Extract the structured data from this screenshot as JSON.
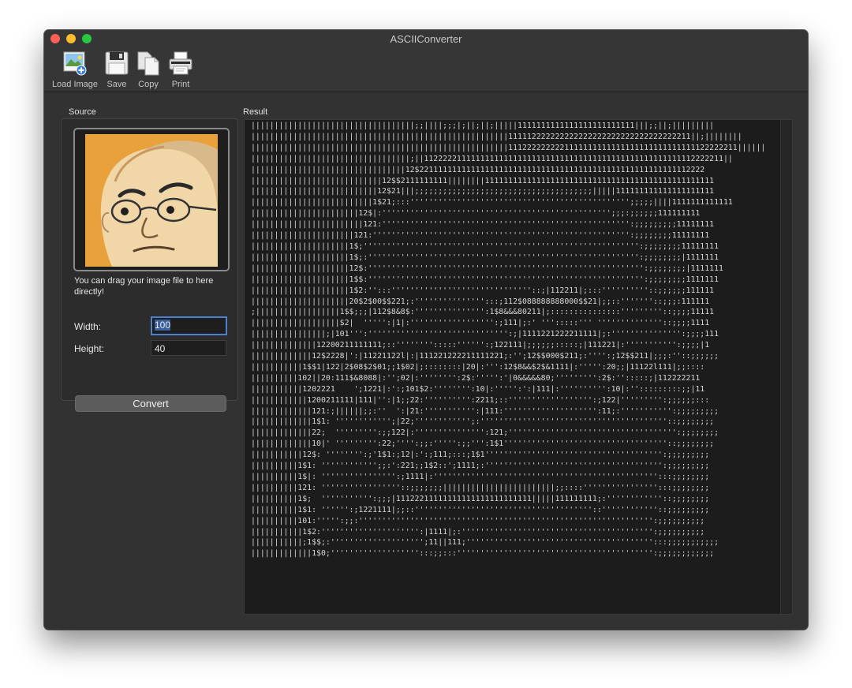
{
  "window": {
    "title": "ASCIIConverter"
  },
  "toolbar": {
    "load_label": "Load Image",
    "save_label": "Save",
    "copy_label": "Copy",
    "print_label": "Print"
  },
  "source": {
    "label": "Source",
    "drop_hint": "You can drag your image file to here directly!",
    "width_label": "Width:",
    "width_value": "100",
    "height_label": "Height:",
    "height_value": "40",
    "convert_label": "Convert"
  },
  "result": {
    "label": "Result",
    "lines": [
      "|||||||||||||||||||||||||||||||||||;;||||;;;|;||;||;|||||1111111111111111111111111|||;;||;|||||||||",
      "|||||||||||||||||||||||||||||||||||||||||||||||||||||||111112222222222222222222222222222222211||;||||||||",
      "|||||||||||||||||||||||||||||||||||||||||||||||||||||||1112222222221111111111111111111111111111122222211||||||",
      "||||||||||||||||||||||||||||||||||;||1122222111111111111111111111111111111111111111111111111112222211||",
      "|||||||||||||||||||||||||||||||||12$2211111111111111111111111111111111111111111111111111111112222",
      "||||||||||||||||||||||||||||12$$2111111111||||||||1111111111111111111111111111111111111111111111111",
      "|||||||||||||||||||||||||||12$21|||;;;;;;;;;;;;;;;;;;;;;;;;;;;;;;;;;;;;;;|||||111111111111111111111",
      "||||||||||||||||||||||||||1$21;:::''''''''''''''''''''''''''''''''''''''''''''''';;;;;||||1111111111111",
      "|||||||||||||||||||||||12$|:''''''''''''''''''''''''''''''''''''''''''''''''';;;:;;;;;;111111111",
      "||||||||||||||||||||||||121:''''''''''''''''''''''''''''''''''''''''''''''''''''':;;;;;;;;;11111111",
      "||||||||||||||||||||||121:''''''''''''''''''''''''''''''''''''''''''''''''''''''':;;;;;;;;11111111",
      "|||||||||||||||||||||1$;''''''''''''''''''''''''''''''''''''''''''''''''''''''''''':;;;;;;;;11111111",
      "|||||||||||||||||||||1$;:'''''''''''''''''''''''''''''''''''''''''''''''''''''''''':;;;;;;;;|1111111",
      "|||||||||||||||||||||12$:''''''''''''''''''''''''''''''''''''''''''''''''''''''''''':;;;;;;;;|1111111",
      "|||||||||||||||||||||1$$:''''''''''''''''''''''''''''''''''''''''''''''''''''''''''':;;;;;;;;1111111",
      "|||||||||||||||||||||1$2:'':::''''''''''''''''''''''''''''''::;|112211|;:::''''''''''::;;;;;;111111",
      "|||||||||||||||||||||20$2$00$$221;:''''''''''''''':::;112$088888888000$$21|;;::'''''''::;;;:111111",
      ";||||||||||||||||||1$$;;;|112$8&8$:''''''''''''''':1$8&&&80211|;:::::::::::::::'''''''''::;;;;11111",
      "|||||||||||||||||||$2|  ''''':|1|:'''''''''''''''''':;111|;:' ''':::::''' ''''''''''''''::;;;;1111",
      "||||||||||||||||;|101''':'''''''''''''''''''''''''''''':;|1111221222211111|;:''''''''''''''':;;;;111",
      "||||||||||||||12200211111111;::'''''''':::::'''''':;122111|;;;;;;:::::;|111221|:''''''''''':;;;;|1",
      "|||||||||||||12$2228|':|11221122l|:|111221222211111221;:'';12$$000$211;:'''':;12$$211|;;;:''::;;;;;;",
      "|||||||||||1$$1|122|2$08$2$01;;1$02|;::::::::|20|:''':12$8&&$2$&1111|:''''':20;;|11122l111|;;::::",
      "||||||||||102||20:111$&8088|:'';02|:'''''''':2$:''''':'|0&&&&&80;''''''''':2$:'':::::;|112222211",
      "|||||||||||1202221    ';1221|:':;101$2:'''''''':10|:''''':':|111|:'''''''''':10|:'':::::::::;;|11",
      "||||||||||||1200211111|111|'':|1;;22:'''''''''':2211;::'''''''''''''''''':;122|''''''''':;;;;;;:::",
      "|||||||||||||121:;||||||;;:''  ':|21:''''''''''':|111:'''''''''''''''''''':11;:''''''''''':;;;;;;;;;",
      "|||||||||||||1$1: '''''''''''';|22;'''''''''''';:''''''''''''''''''''''''''''''''''''''''::;;;;;;;;",
      "|||||||||||||22;  ''''''''':;;122|:''''''''''''''':121;'''''''''''''''''''''''''''''''''''':;;;;;;;;",
      "|||||||||||||10|' ''''''''':22;'''':;;:''''':;;''':1$1'''''''''''''''''''''''''''''''''''::;;;;;;;;",
      "|||||||||||12$: '''''''':;'1$1:;12|:':;111;:::;1$1'''''''''''''''''''''''''''''''''''''':;;;;;;;;;",
      "||||||||||1$1: '''''''''''';;:':221;;1$2::';1111;:'''''''''''''''''''''''''''''''''''''':;;;;;;;;;",
      "||||||||||1$|: '''''''''''''''':;1111|:'''''''''''''''''''''''''''''''''''''''''''''''':::;;;;;;;;",
      "||||||||||121: '''''''''''''''''::;;;;;;;||||||||||||||||||||||||;;::::'''''''''''''''':::;;;;;;;;",
      "||||||||||1$;  ''''''''''':;;;|11122211111111111111111111111|||||111111111;:''''''''''''::;;;;;;;;",
      "||||||||||1$1: '''''':;1221111|;;::''''''''''''''''''''''''''''''''''''''::''''''''''''::;;;;;;;;;",
      "||||||||||101:''''':;;:''''''''''''''''''''''''''''''''''''''''''''''''''''''''''''''':;;;;;;;;;;",
      "|||||||||||1$2:''''''''''''''''''''':|1111|;:''''''''''''''''''''''''''''''''''''''''':;;;;;;;;;;",
      "|||||||||||;1$$;:'''''''''''''''''''';11||111;'''''''''''''''''''''''''''''''''''''''':::;;;;;;;;;;;",
      "|||||||||||||1$0;''''''''''''''''''':::;;:::'''''''''''''''''''''''''''''''''''''''''':;;;;;;;;;;;;"
    ]
  }
}
